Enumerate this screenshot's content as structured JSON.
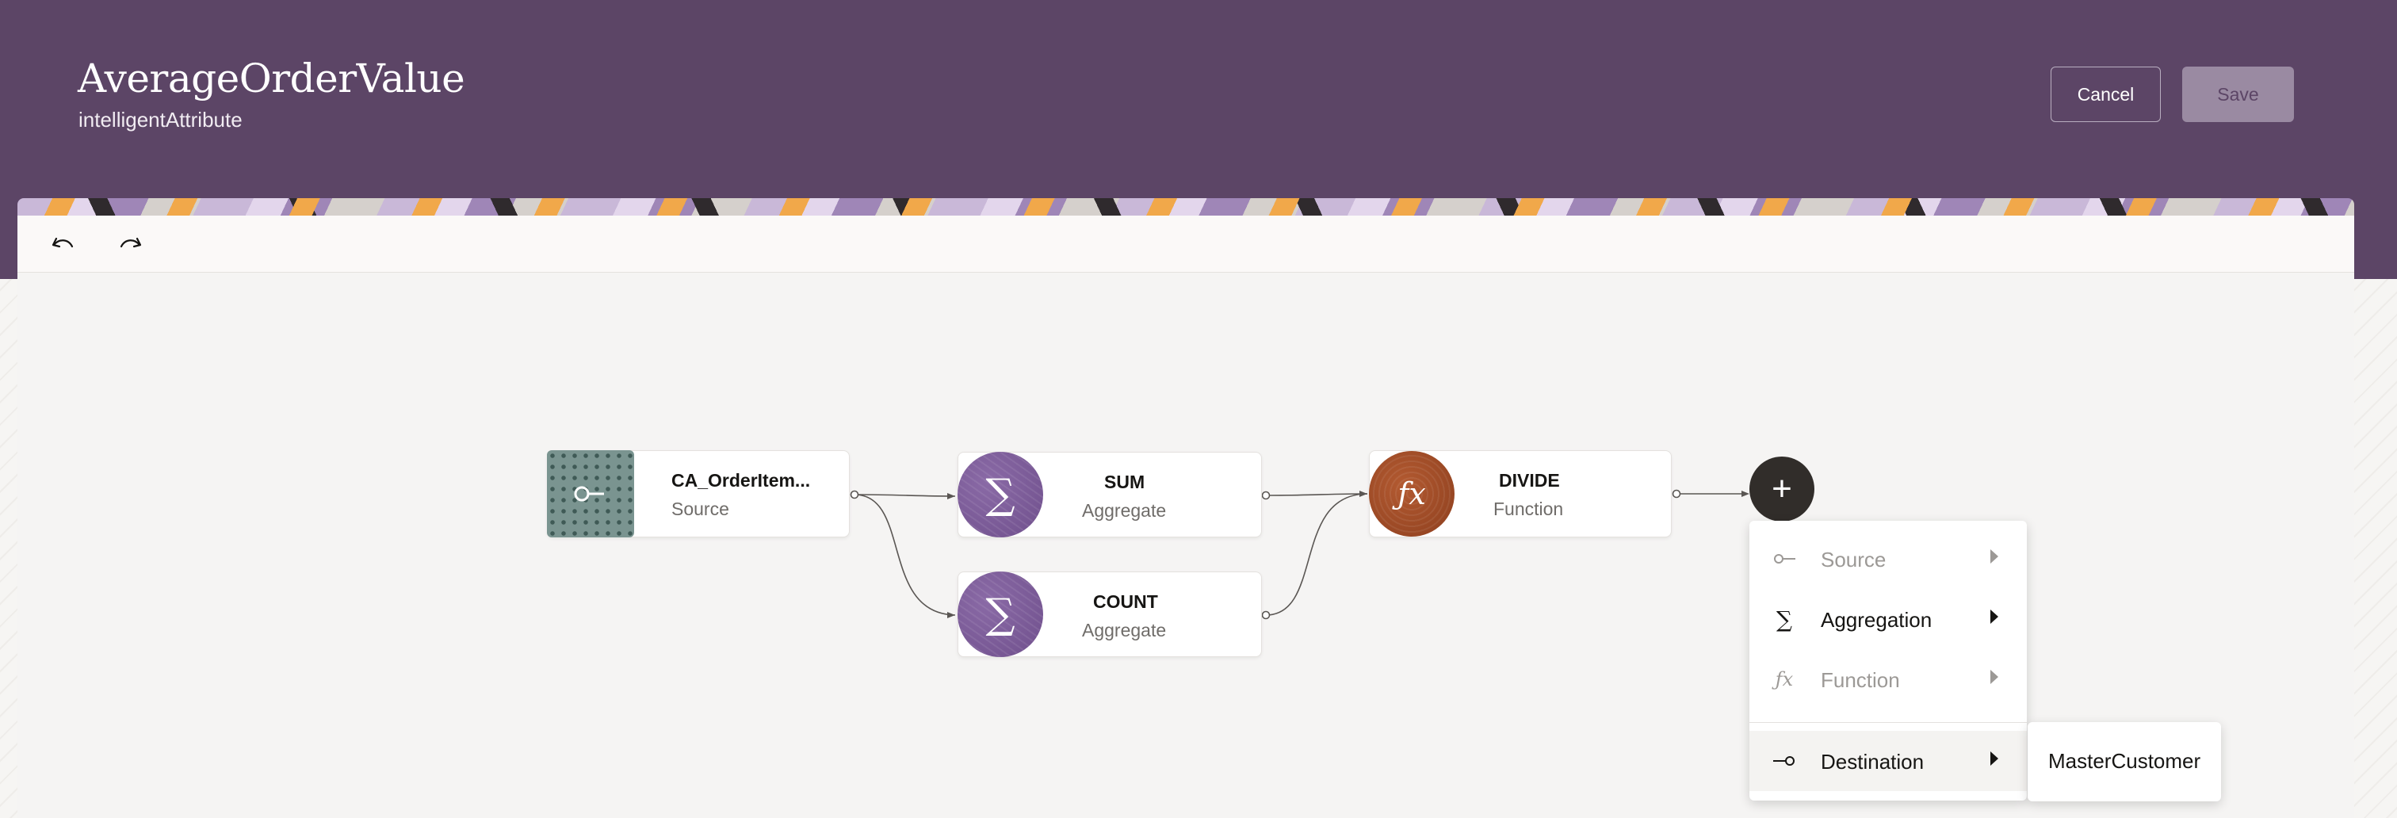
{
  "header": {
    "title": "AverageOrderValue",
    "subtitle": "intelligentAttribute",
    "cancel_label": "Cancel",
    "save_label": "Save",
    "background_color": "#5c4566"
  },
  "toolbar": {
    "undo_icon": "undo-icon",
    "redo_icon": "redo-icon"
  },
  "canvas": {
    "nodes": [
      {
        "id": "source",
        "title": "CA_OrderItem...",
        "subtitle": "Source",
        "icon": "source-key-icon"
      },
      {
        "id": "sum",
        "title": "SUM",
        "subtitle": "Aggregate",
        "icon": "sigma-icon",
        "glyph": "∑"
      },
      {
        "id": "count",
        "title": "COUNT",
        "subtitle": "Aggregate",
        "icon": "sigma-icon",
        "glyph": "∑"
      },
      {
        "id": "divide",
        "title": "DIVIDE",
        "subtitle": "Function",
        "icon": "function-icon",
        "glyph": "ƒx"
      }
    ],
    "add_button": {
      "glyph": "+",
      "icon": "plus-icon"
    }
  },
  "add_menu": {
    "items": [
      {
        "label": "Source",
        "icon": "source-icon",
        "glyph": "○—",
        "enabled": false
      },
      {
        "label": "Aggregation",
        "icon": "sigma-icon",
        "glyph": "∑",
        "enabled": true
      },
      {
        "label": "Function",
        "icon": "function-icon",
        "glyph": "ƒx",
        "enabled": false
      },
      {
        "label": "Destination",
        "icon": "destination-icon",
        "glyph": "—○",
        "enabled": true,
        "active": true
      }
    ],
    "submenu": {
      "items": [
        "MasterCustomer"
      ]
    }
  }
}
